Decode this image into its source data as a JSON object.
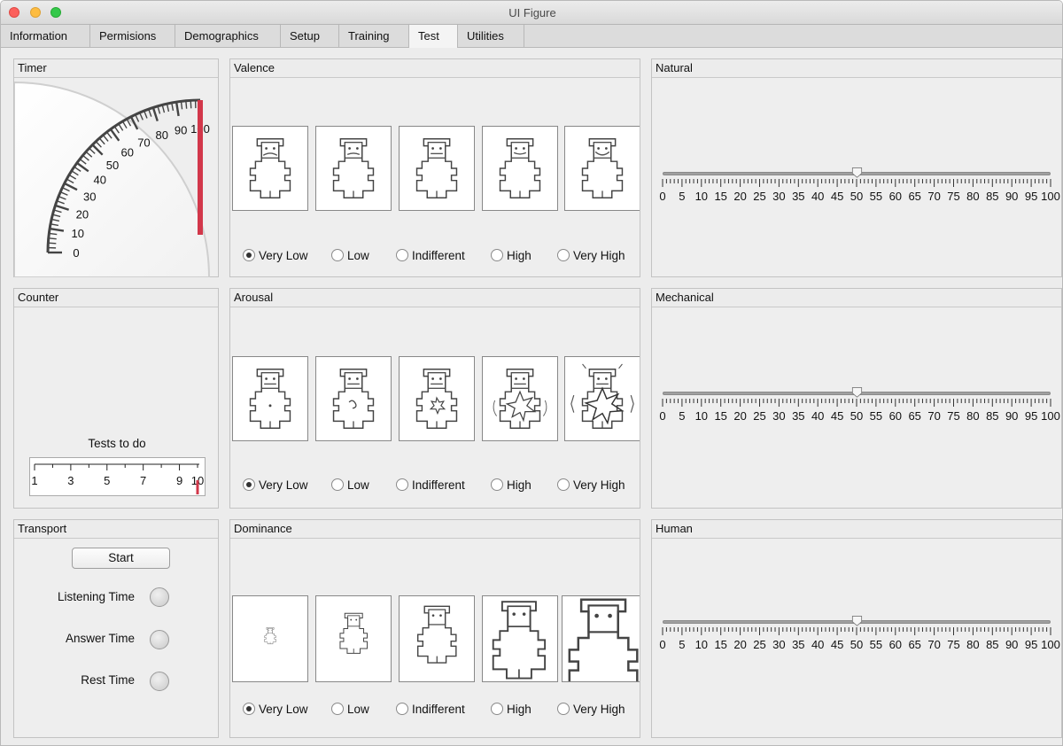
{
  "window": {
    "title": "UI Figure"
  },
  "tabs": [
    {
      "label": "Information",
      "active": false
    },
    {
      "label": "Permisions",
      "active": false
    },
    {
      "label": "Demographics",
      "active": false
    },
    {
      "label": "Setup",
      "active": false
    },
    {
      "label": "Training",
      "active": false
    },
    {
      "label": "Test",
      "active": true
    },
    {
      "label": "Utilities",
      "active": false
    }
  ],
  "timer": {
    "title": "Timer",
    "value": 100,
    "min": 0,
    "max": 100,
    "tick_labels": [
      "0",
      "10",
      "20",
      "30",
      "40",
      "50",
      "60",
      "70",
      "80",
      "90",
      "100"
    ],
    "needle_color": "#d2374a"
  },
  "counter": {
    "title": "Counter",
    "caption": "Tests to do",
    "value": 10,
    "tick_labels": [
      "1",
      "3",
      "5",
      "7",
      "9",
      "10"
    ],
    "needle_color": "#d2374a"
  },
  "transport": {
    "title": "Transport",
    "start_label": "Start",
    "lamps": [
      {
        "label": "Listening Time"
      },
      {
        "label": "Answer Time"
      },
      {
        "label": "Rest Time"
      }
    ]
  },
  "rating_options": [
    "Very Low",
    "Low",
    "Indifferent",
    "High",
    "Very High"
  ],
  "valence": {
    "title": "Valence",
    "selected": "Very Low"
  },
  "arousal": {
    "title": "Arousal",
    "selected": "Very Low"
  },
  "dominance": {
    "title": "Dominance",
    "selected": "Very Low"
  },
  "slider_ticks": [
    "0",
    "5",
    "10",
    "15",
    "20",
    "25",
    "30",
    "35",
    "40",
    "45",
    "50",
    "55",
    "60",
    "65",
    "70",
    "75",
    "80",
    "85",
    "90",
    "95",
    "100"
  ],
  "natural": {
    "title": "Natural",
    "value": 50
  },
  "mechanical": {
    "title": "Mechanical",
    "value": 50
  },
  "human": {
    "title": "Human",
    "value": 50
  }
}
